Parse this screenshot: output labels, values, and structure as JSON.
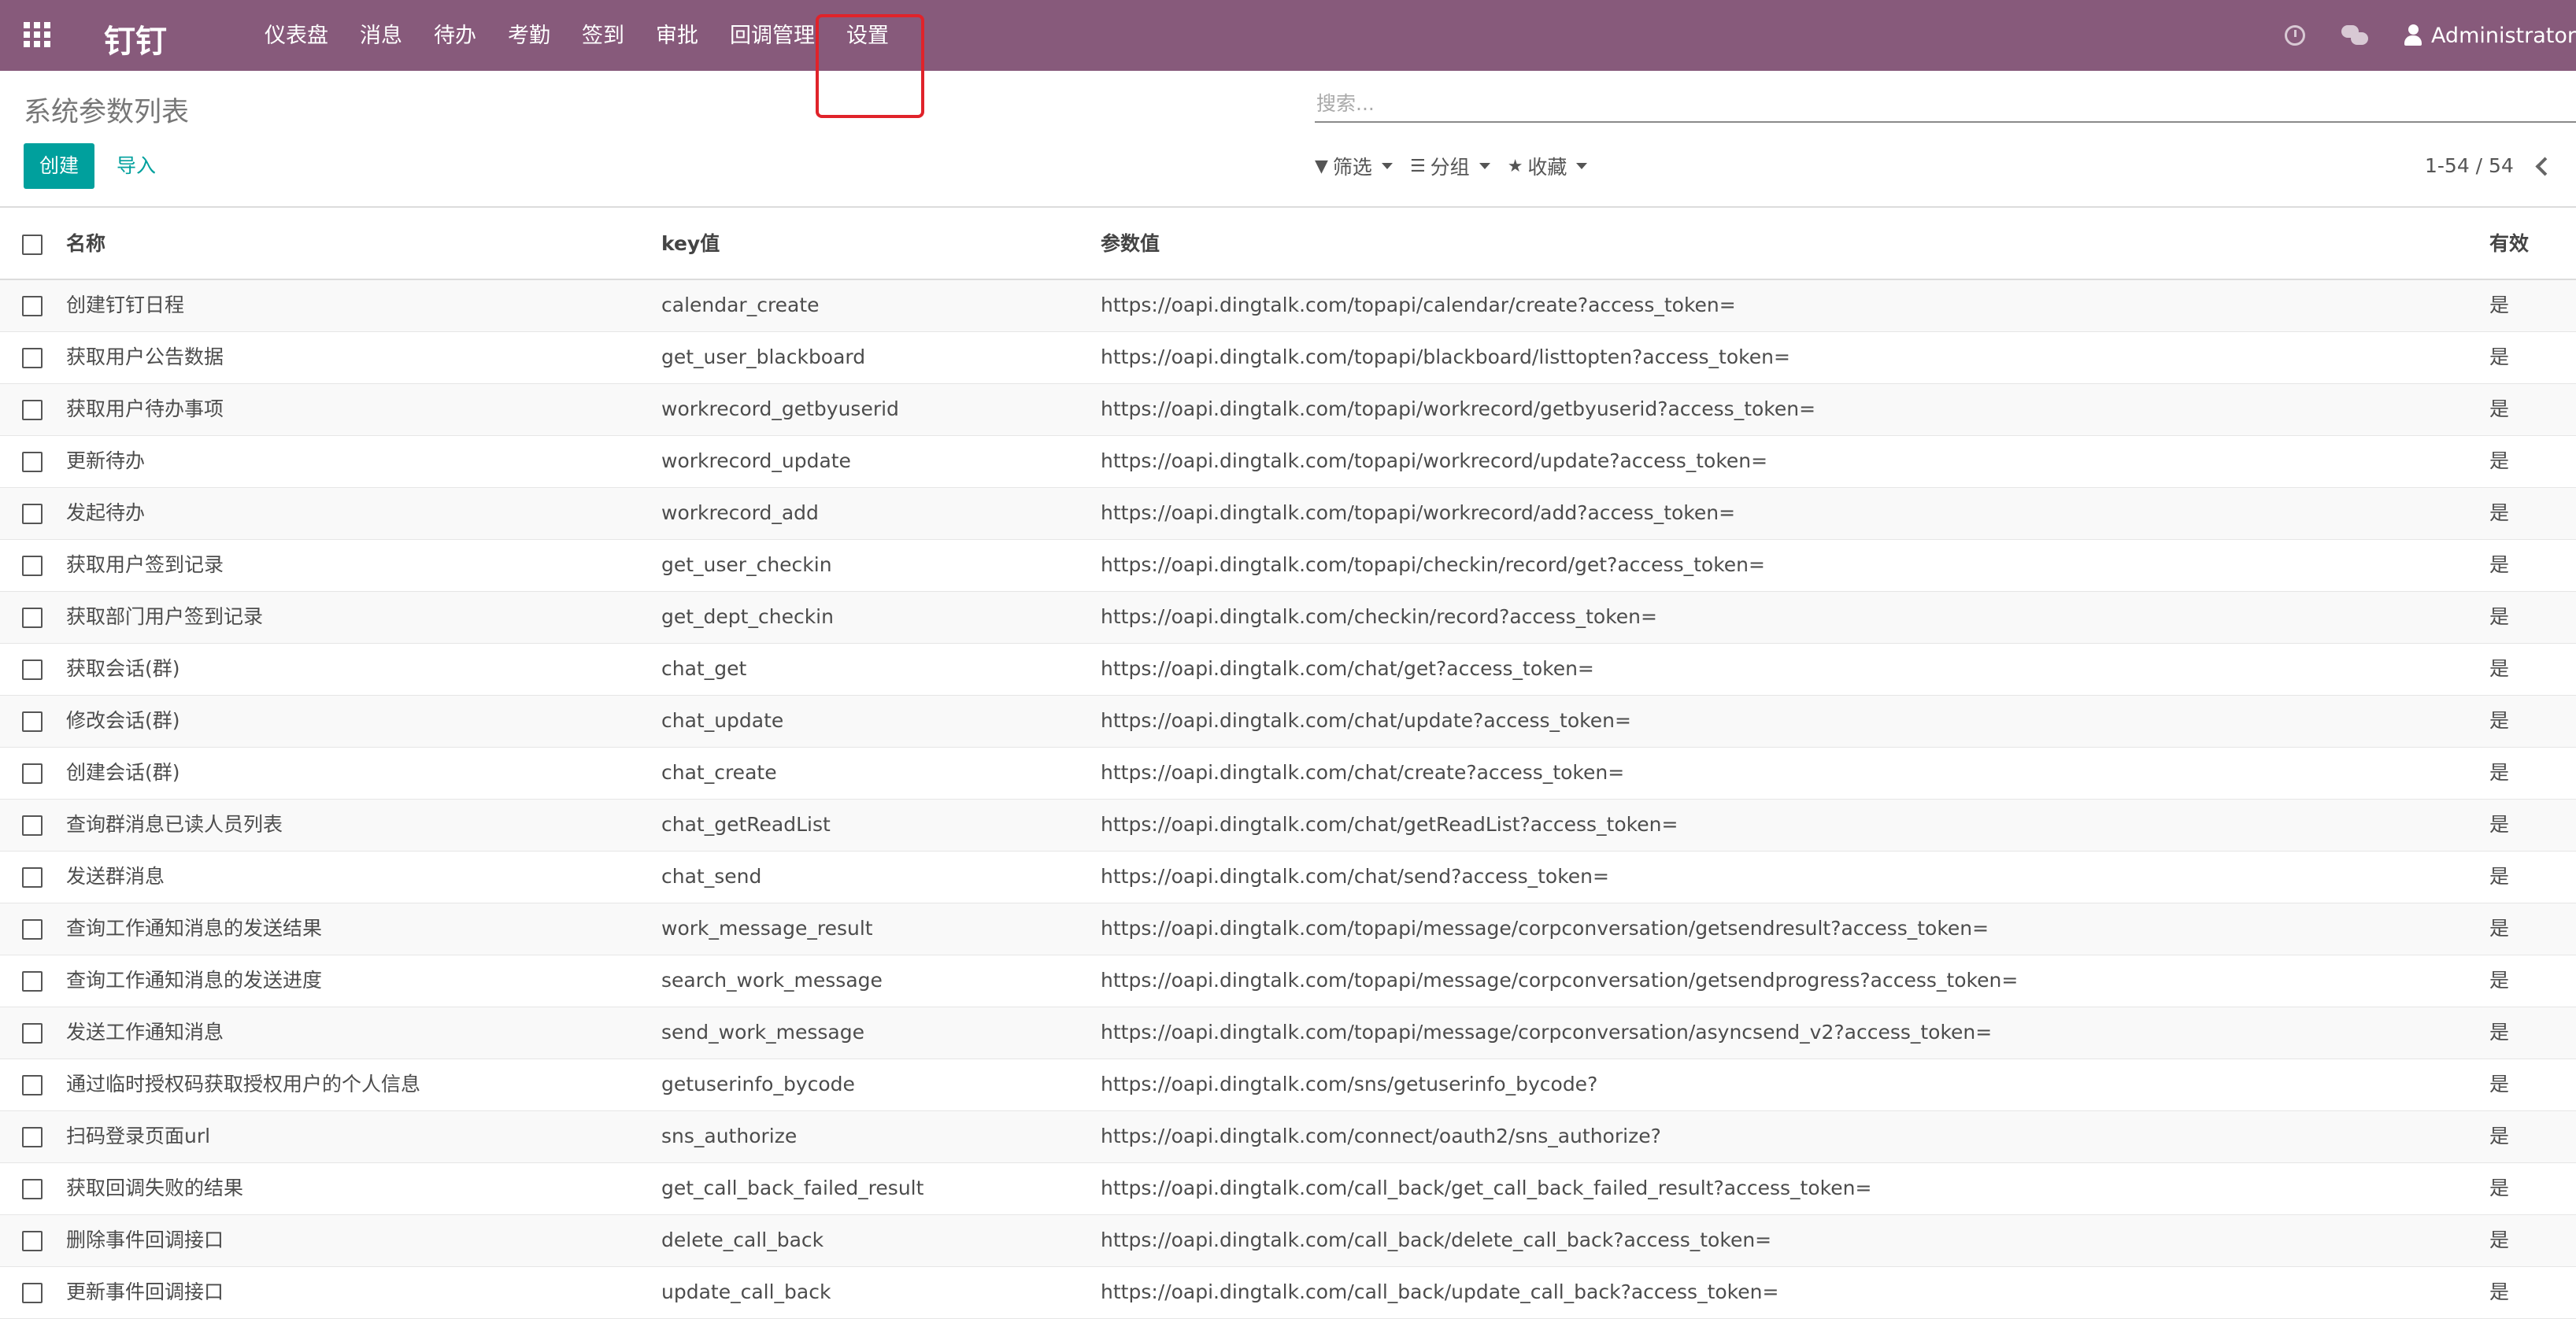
{
  "navbar": {
    "brand": "钉钉",
    "menu": [
      "仪表盘",
      "消息",
      "待办",
      "考勤",
      "签到",
      "审批",
      "回调管理",
      "设置"
    ],
    "user": "Administrator",
    "color": "#875a7b",
    "icons": [
      "apps-grid-icon",
      "clock-icon",
      "chat-icon",
      "user-icon"
    ]
  },
  "page": {
    "title": "系统参数列表",
    "search_placeholder": "搜索...",
    "create_label": "创建",
    "import_label": "导入",
    "filter_label": "筛选",
    "group_label": "分组",
    "favorite_label": "收藏",
    "pager": "1-54 / 54",
    "accent": "#00a09d"
  },
  "table": {
    "headers": [
      "名称",
      "key值",
      "参数值",
      "有效"
    ],
    "rows": [
      {
        "name": "创建钉钉日程",
        "key": "calendar_create",
        "value": "https://oapi.dingtalk.com/topapi/calendar/create?access_token=",
        "active": "是"
      },
      {
        "name": "获取用户公告数据",
        "key": "get_user_blackboard",
        "value": "https://oapi.dingtalk.com/topapi/blackboard/listtopten?access_token=",
        "active": "是"
      },
      {
        "name": "获取用户待办事项",
        "key": "workrecord_getbyuserid",
        "value": "https://oapi.dingtalk.com/topapi/workrecord/getbyuserid?access_token=",
        "active": "是"
      },
      {
        "name": "更新待办",
        "key": "workrecord_update",
        "value": "https://oapi.dingtalk.com/topapi/workrecord/update?access_token=",
        "active": "是"
      },
      {
        "name": "发起待办",
        "key": "workrecord_add",
        "value": "https://oapi.dingtalk.com/topapi/workrecord/add?access_token=",
        "active": "是"
      },
      {
        "name": "获取用户签到记录",
        "key": "get_user_checkin",
        "value": "https://oapi.dingtalk.com/topapi/checkin/record/get?access_token=",
        "active": "是"
      },
      {
        "name": "获取部门用户签到记录",
        "key": "get_dept_checkin",
        "value": "https://oapi.dingtalk.com/checkin/record?access_token=",
        "active": "是"
      },
      {
        "name": "获取会话(群)",
        "key": "chat_get",
        "value": "https://oapi.dingtalk.com/chat/get?access_token=",
        "active": "是"
      },
      {
        "name": "修改会话(群)",
        "key": "chat_update",
        "value": "https://oapi.dingtalk.com/chat/update?access_token=",
        "active": "是"
      },
      {
        "name": "创建会话(群)",
        "key": "chat_create",
        "value": "https://oapi.dingtalk.com/chat/create?access_token=",
        "active": "是"
      },
      {
        "name": "查询群消息已读人员列表",
        "key": "chat_getReadList",
        "value": "https://oapi.dingtalk.com/chat/getReadList?access_token=",
        "active": "是"
      },
      {
        "name": "发送群消息",
        "key": "chat_send",
        "value": "https://oapi.dingtalk.com/chat/send?access_token=",
        "active": "是"
      },
      {
        "name": "查询工作通知消息的发送结果",
        "key": "work_message_result",
        "value": "https://oapi.dingtalk.com/topapi/message/corpconversation/getsendresult?access_token=",
        "active": "是"
      },
      {
        "name": "查询工作通知消息的发送进度",
        "key": "search_work_message",
        "value": "https://oapi.dingtalk.com/topapi/message/corpconversation/getsendprogress?access_token=",
        "active": "是"
      },
      {
        "name": "发送工作通知消息",
        "key": "send_work_message",
        "value": "https://oapi.dingtalk.com/topapi/message/corpconversation/asyncsend_v2?access_token=",
        "active": "是"
      },
      {
        "name": "通过临时授权码获取授权用户的个人信息",
        "key": "getuserinfo_bycode",
        "value": "https://oapi.dingtalk.com/sns/getuserinfo_bycode?",
        "active": "是"
      },
      {
        "name": "扫码登录页面url",
        "key": "sns_authorize",
        "value": "https://oapi.dingtalk.com/connect/oauth2/sns_authorize?",
        "active": "是"
      },
      {
        "name": "获取回调失败的结果",
        "key": "get_call_back_failed_result",
        "value": "https://oapi.dingtalk.com/call_back/get_call_back_failed_result?access_token=",
        "active": "是"
      },
      {
        "name": "删除事件回调接口",
        "key": "delete_call_back",
        "value": "https://oapi.dingtalk.com/call_back/delete_call_back?access_token=",
        "active": "是"
      },
      {
        "name": "更新事件回调接口",
        "key": "update_call_back",
        "value": "https://oapi.dingtalk.com/call_back/update_call_back?access_token=",
        "active": "是"
      }
    ]
  }
}
